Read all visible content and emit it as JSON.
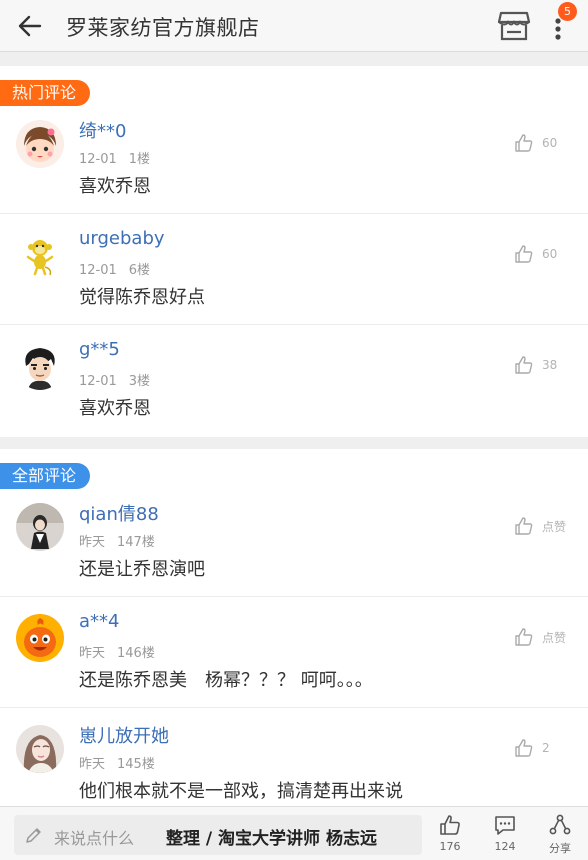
{
  "header": {
    "title": "罗莱家纺官方旗舰店",
    "badge_count": "5"
  },
  "hot": {
    "tag": "热门评论",
    "comments": [
      {
        "user": "绮**0",
        "date": "12-01",
        "floor": "1楼",
        "text": "喜欢乔恩",
        "likes": "60",
        "avatar": "girl-avatar"
      },
      {
        "user": "urgebaby",
        "date": "12-01",
        "floor": "6楼",
        "text": "觉得陈乔恩好点",
        "likes": "60",
        "avatar": "monkey-avatar"
      },
      {
        "user": "g**5",
        "date": "12-01",
        "floor": "3楼",
        "text": "喜欢乔恩",
        "likes": "38",
        "avatar": "cartoon-boy-avatar"
      }
    ]
  },
  "all": {
    "tag": "全部评论",
    "comments": [
      {
        "user": "qian倩88",
        "date": "昨天",
        "floor": "147楼",
        "text": "还是让乔恩演吧",
        "likes": "点赞",
        "avatar": "photo-avatar"
      },
      {
        "user": "a**4",
        "date": "昨天",
        "floor": "146楼",
        "text": "还是陈乔恩美　杨幂？？？ 呵呵。。。",
        "likes": "点赞",
        "avatar": "orange-mascot-avatar"
      },
      {
        "user": "崽儿放开她",
        "date": "昨天",
        "floor": "145楼",
        "text": "他们根本就不是一部戏，搞清楚再出来说",
        "likes": "2",
        "avatar": "woman-photo-avatar"
      }
    ]
  },
  "bottom": {
    "placeholder": "来说点什么",
    "watermark": "整理 / 淘宝大学讲师 杨志远",
    "like_count": "176",
    "comment_count": "124",
    "share_label": "分享"
  },
  "colors": {
    "hot_tag": "#ff6a12",
    "all_tag": "#3e91e8",
    "username": "#3d6fb6",
    "badge": "#ff5b1a"
  }
}
